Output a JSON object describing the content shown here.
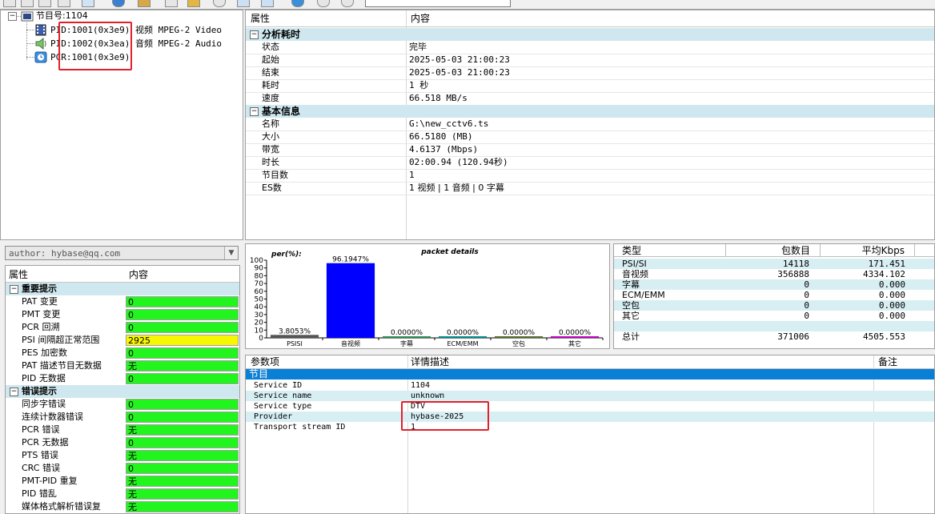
{
  "tree": {
    "root": {
      "label": "节目号:1104",
      "icon": "program-icon"
    },
    "items": [
      {
        "label": "PID:1001(0x3e9) 视频 MPEG-2 Video",
        "icon": "film-icon"
      },
      {
        "label": "PID:1002(0x3ea) 音频 MPEG-2 Audio",
        "icon": "speaker-icon"
      },
      {
        "label": "PCR:1001(0x3e9)",
        "icon": "clock-icon"
      }
    ],
    "collapse_symbol": "−"
  },
  "props": {
    "col_key": "属性",
    "col_value": "内容",
    "sections": [
      {
        "title": "分析耗时",
        "rows": [
          {
            "k": "状态",
            "v": "完毕"
          },
          {
            "k": "起始",
            "v": "2025-05-03 21:00:23"
          },
          {
            "k": "结束",
            "v": "2025-05-03 21:00:23"
          },
          {
            "k": "耗时",
            "v": "1 秒"
          },
          {
            "k": "速度",
            "v": "66.518 MB/s"
          }
        ]
      },
      {
        "title": "基本信息",
        "rows": [
          {
            "k": "名称",
            "v": "G:\\new_cctv6.ts"
          },
          {
            "k": "大小",
            "v": "66.5180 (MB)"
          },
          {
            "k": "带宽",
            "v": "4.6137 (Mbps)"
          },
          {
            "k": "时长",
            "v": "02:00.94 (120.94秒)"
          },
          {
            "k": "节目数",
            "v": "1"
          },
          {
            "k": "ES数",
            "v": "1 视频 | 1 音频 | 0 字幕"
          }
        ]
      }
    ]
  },
  "author": {
    "value": "author: hybase@qq.com",
    "dropdown_symbol": "▼"
  },
  "alerts": {
    "col_key": "属性",
    "col_value": "内容",
    "sections": [
      {
        "title": "重要提示",
        "rows": [
          {
            "k": "PAT 变更",
            "v": "0",
            "status": "green"
          },
          {
            "k": "PMT 变更",
            "v": "0",
            "status": "green"
          },
          {
            "k": "PCR 回溯",
            "v": "0",
            "status": "green"
          },
          {
            "k": "PSI 间隔超正常范围",
            "v": "2925",
            "status": "yellow"
          },
          {
            "k": "PES 加密数",
            "v": "0",
            "status": "green"
          },
          {
            "k": "PAT 描述节目无数据",
            "v": "无",
            "status": "green"
          },
          {
            "k": "PID 无数据",
            "v": "0",
            "status": "green"
          }
        ]
      },
      {
        "title": "错误提示",
        "rows": [
          {
            "k": "同步字错误",
            "v": "0",
            "status": "green"
          },
          {
            "k": "连续计数器错误",
            "v": "0",
            "status": "green"
          },
          {
            "k": "PCR 错误",
            "v": "无",
            "status": "green"
          },
          {
            "k": "PCR 无数据",
            "v": "0",
            "status": "green"
          },
          {
            "k": "PTS 错误",
            "v": "无",
            "status": "green"
          },
          {
            "k": "CRC 错误",
            "v": "0",
            "status": "green"
          },
          {
            "k": "PMT-PID 重复",
            "v": "无",
            "status": "green"
          },
          {
            "k": "PID 错乱",
            "v": "无",
            "status": "green"
          },
          {
            "k": "媒体格式解析错误复",
            "v": "无",
            "status": "green"
          }
        ]
      }
    ]
  },
  "chart_data": {
    "type": "bar",
    "title": "packet details",
    "ylabel": "per(%):",
    "ylim": [
      0,
      100
    ],
    "yticks": [
      "0",
      "10",
      "20",
      "30",
      "40",
      "50",
      "60",
      "70",
      "80",
      "90",
      "100"
    ],
    "categories": [
      "PSISI",
      "音视频",
      "字幕",
      "ECM/EMM",
      "空包",
      "其它"
    ],
    "values": [
      3.8053,
      96.1947,
      0.0,
      0.0,
      0.0,
      0.0
    ],
    "labels": [
      "3.8053%",
      "96.1947%",
      "0.0000%",
      "0.0000%",
      "0.0000%",
      "0.0000%"
    ],
    "colors": [
      "#555555",
      "#0000ff",
      "#2e8b57",
      "#008b8b",
      "#556b2f",
      "#c000c0"
    ]
  },
  "types": {
    "headers": [
      "类型",
      "包数目",
      "平均Kbps"
    ],
    "rows": [
      {
        "t": "PSI/SI",
        "n": "14118",
        "k": "171.451"
      },
      {
        "t": "音视频",
        "n": "356888",
        "k": "4334.102"
      },
      {
        "t": "字幕",
        "n": "0",
        "k": "0.000"
      },
      {
        "t": "ECM/EMM",
        "n": "0",
        "k": "0.000"
      },
      {
        "t": "空包",
        "n": "0",
        "k": "0.000"
      },
      {
        "t": "其它",
        "n": "0",
        "k": "0.000"
      },
      {
        "t": "",
        "n": "",
        "k": ""
      },
      {
        "t": "总计",
        "n": "371006",
        "k": "4505.553"
      }
    ]
  },
  "params": {
    "headers": [
      "参数项",
      "详情描述",
      "备注"
    ],
    "group": "节目",
    "rows": [
      {
        "k": "Service ID",
        "v": "1104"
      },
      {
        "k": "Service name",
        "v": "unknown"
      },
      {
        "k": "Service type",
        "v": "DTV"
      },
      {
        "k": "Provider",
        "v": "hybase-2025"
      },
      {
        "k": "Transport stream ID",
        "v": "1"
      }
    ]
  }
}
